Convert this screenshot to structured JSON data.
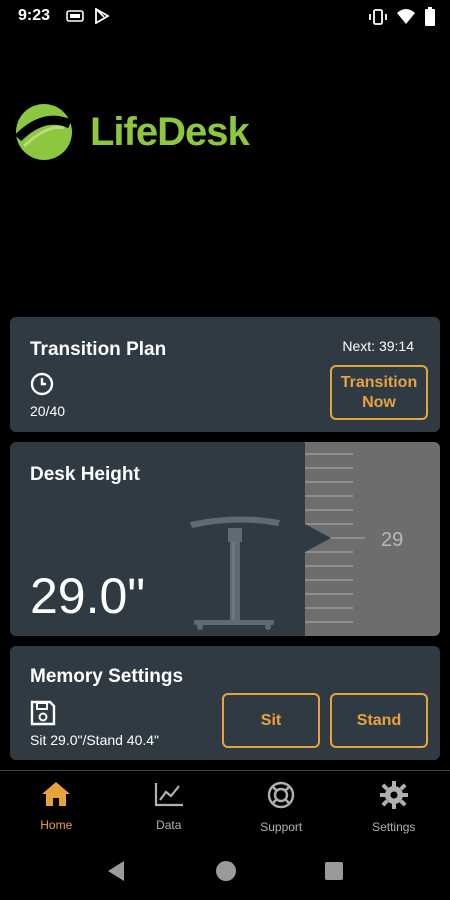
{
  "status_bar": {
    "time": "9:23",
    "left_icons": [
      "sim-card-icon",
      "play-store-icon"
    ],
    "right_icons": [
      "vibrate-icon",
      "wifi-icon",
      "battery-icon"
    ]
  },
  "brand": {
    "name": "LifeDesk",
    "color": "#8dc63f"
  },
  "colors": {
    "accent": "#e8a33d",
    "card": "#2f3a43",
    "ruler": "#6d6d6d"
  },
  "transition_plan": {
    "title": "Transition Plan",
    "next": "Next: 39:14",
    "progress": "20/40",
    "button_line1": "Transition",
    "button_line2": "Now"
  },
  "desk_height": {
    "title": "Desk Height",
    "value": "29.0\"",
    "ruler_value": "29"
  },
  "memory_settings": {
    "title": "Memory Settings",
    "summary": "Sit 29.0\"/Stand 40.4\"",
    "sit_label": "Sit",
    "stand_label": "Stand"
  },
  "bottom_nav": {
    "home": "Home",
    "data": "Data",
    "support": "Support",
    "settings": "Settings",
    "active": "home"
  }
}
